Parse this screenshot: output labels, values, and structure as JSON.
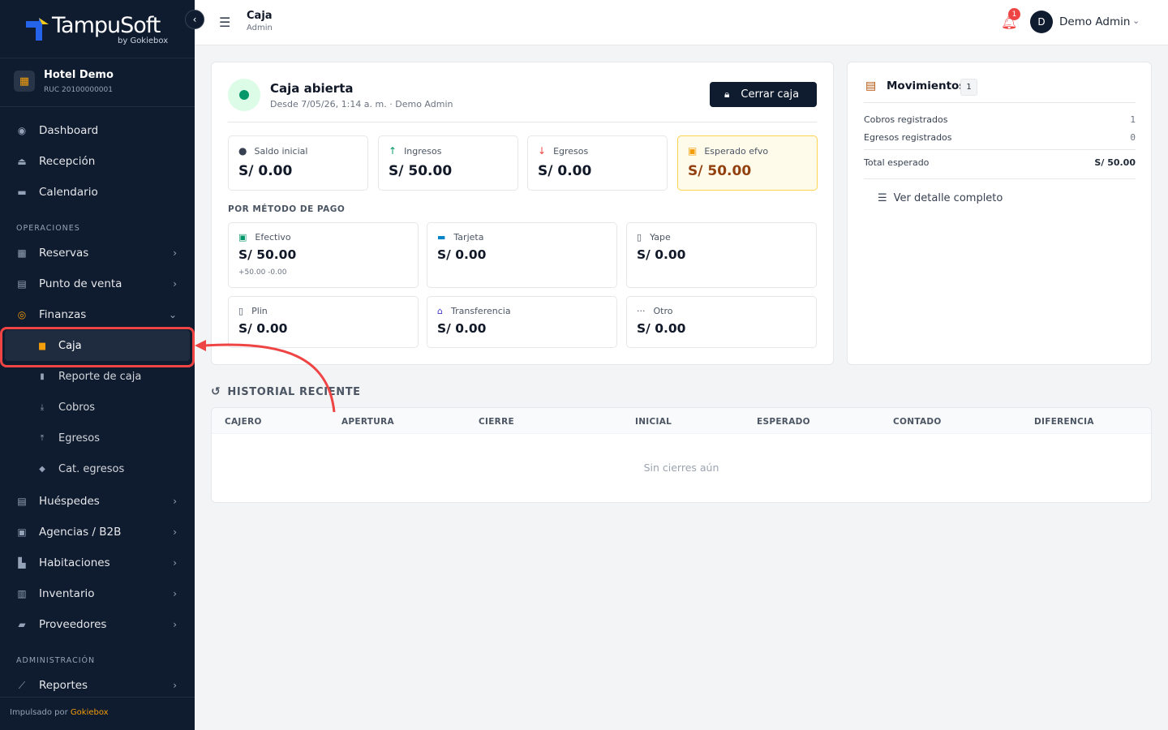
{
  "brand": {
    "name": "TampuSoft",
    "by": "by Gokiebox"
  },
  "hotel": {
    "name": "Hotel Demo",
    "ruc": "RUC 20100000001"
  },
  "nav": {
    "dashboard": "Dashboard",
    "recepcion": "Recepción",
    "calendario": "Calendario",
    "section_operaciones": "OPERACIONES",
    "reservas": "Reservas",
    "punto_venta": "Punto de venta",
    "finanzas": "Finanzas",
    "sub": {
      "caja": "Caja",
      "reporte_caja": "Reporte de caja",
      "cobros": "Cobros",
      "egresos": "Egresos",
      "cat_egresos": "Cat. egresos"
    },
    "huespedes": "Huéspedes",
    "agencias": "Agencias / B2B",
    "habitaciones": "Habitaciones",
    "inventario": "Inventario",
    "proveedores": "Proveedores",
    "section_admin": "ADMINISTRACIÓN",
    "reportes": "Reportes"
  },
  "footer": {
    "prefix": "Impulsado por",
    "brand": "Gokiebox"
  },
  "topbar": {
    "title": "Caja",
    "subtitle": "Admin",
    "notifications": "1",
    "avatar_initial": "D",
    "user": "Demo Admin"
  },
  "caja": {
    "status": "Caja abierta",
    "since": "Desde 7/05/26, 1:14 a. m. · Demo Admin",
    "close_button": "Cerrar caja",
    "stats": [
      {
        "label": "Saldo inicial",
        "value": "S/ 0.00",
        "icon": "piggy-icon"
      },
      {
        "label": "Ingresos",
        "value": "S/ 50.00",
        "icon": "arrow-up-icon"
      },
      {
        "label": "Egresos",
        "value": "S/ 0.00",
        "icon": "arrow-down-icon"
      },
      {
        "label": "Esperado efvo",
        "value": "S/ 50.00",
        "icon": "cash-icon"
      }
    ],
    "method_section": "POR MÉTODO DE PAGO",
    "methods": [
      {
        "label": "Efectivo",
        "value": "S/ 50.00",
        "detail": "+50.00 -0.00"
      },
      {
        "label": "Tarjeta",
        "value": "S/ 0.00"
      },
      {
        "label": "Yape",
        "value": "S/ 0.00"
      },
      {
        "label": "Plin",
        "value": "S/ 0.00"
      },
      {
        "label": "Transferencia",
        "value": "S/ 0.00"
      },
      {
        "label": "Otro",
        "value": "S/ 0.00"
      }
    ]
  },
  "movimientos": {
    "title": "Movimientos",
    "count": "1",
    "cobros_label": "Cobros registrados",
    "cobros_value": "1",
    "egresos_label": "Egresos registrados",
    "egresos_value": "0",
    "total_label": "Total esperado",
    "total_value": "S/ 50.00",
    "link": "Ver detalle completo"
  },
  "historial": {
    "title": "HISTORIAL RECIENTE",
    "columns": [
      "CAJERO",
      "APERTURA",
      "CIERRE",
      "INICIAL",
      "ESPERADO",
      "CONTADO",
      "DIFERENCIA"
    ],
    "empty": "Sin cierres aún"
  },
  "colors": {
    "sidebar": "#0f1b2e",
    "accent": "#f59e0b",
    "success": "#059669",
    "danger": "#ef4444"
  }
}
